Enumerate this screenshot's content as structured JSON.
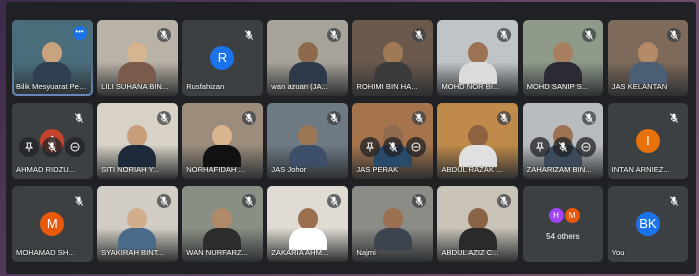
{
  "participants": [
    {
      "id": "p1",
      "name": "Bilik Mesyuarat Perdana",
      "type": "video",
      "bg": "#4a6d7c",
      "skin": "#c9a27e",
      "shirt": "#2f4050",
      "active": true,
      "options": "•••"
    },
    {
      "id": "p2",
      "name": "LILI SUHANA BIN...",
      "type": "video",
      "bg": "#b9b2a6",
      "skin": "#d6b48f",
      "shirt": "#7a5a4a"
    },
    {
      "id": "p3",
      "name": "Rusfahizan",
      "type": "avatar",
      "letter": "R",
      "avatar_color": "#1a73e8"
    },
    {
      "id": "p4",
      "name": "wan azuan (JA...",
      "type": "video",
      "bg": "#a8a39a",
      "skin": "#8e6a4c",
      "shirt": "#2e3a4a"
    },
    {
      "id": "p5",
      "name": "ROHIMI BIN HA...",
      "type": "video",
      "bg": "#6b5a4c",
      "skin": "#a07a58",
      "shirt": "#3b3b3b"
    },
    {
      "id": "p6",
      "name": "MOHD NOR BI...",
      "type": "video",
      "bg": "#bfc4c6",
      "skin": "#9b7354",
      "shirt": "#dcdcdc"
    },
    {
      "id": "p7",
      "name": "MOHD SANIP S...",
      "type": "video",
      "bg": "#8f9a8a",
      "skin": "#a87f5e",
      "shirt": "#2b2b33"
    },
    {
      "id": "p8",
      "name": "JAS KELANTAN",
      "type": "video",
      "bg": "#7d6a5a",
      "skin": "#b58a66",
      "shirt": "#4b5e73"
    },
    {
      "id": "p9",
      "name": "AHMAD RIDZU...",
      "type": "avatar",
      "letter": "A",
      "avatar_color": "#c5442f",
      "pinbar": true
    },
    {
      "id": "p10",
      "name": "SITI NORIAH Y...",
      "type": "video",
      "bg": "#d8d2c6",
      "skin": "#c79d7a",
      "shirt": "#1e2a3a"
    },
    {
      "id": "p11",
      "name": "NORHAFIDAH ...",
      "type": "video",
      "bg": "#9c8c7c",
      "skin": "#d9b48e",
      "shirt": "#111111"
    },
    {
      "id": "p12",
      "name": "JAS Johor",
      "type": "video",
      "bg": "#6e7a84",
      "skin": "#9d7656",
      "shirt": "#3c4e68"
    },
    {
      "id": "p13",
      "name": "JAS PERAK",
      "type": "video",
      "bg": "#a5744c",
      "skin": "#8f6a4c",
      "shirt": "#2a4a6a",
      "pinbar": true
    },
    {
      "id": "p14",
      "name": "ABDUL RAZAK ...",
      "type": "video",
      "bg": "#c08a4a",
      "skin": "#8c6242",
      "shirt": "#e0e0e0"
    },
    {
      "id": "p15",
      "name": "ZAHARIZAM BIN...",
      "type": "video",
      "bg": "#b9bcbe",
      "skin": "#9c7252",
      "shirt": "#3a4a5a",
      "pinbar": true
    },
    {
      "id": "p16",
      "name": "INTAN ARNIEZ...",
      "type": "avatar",
      "letter": "I",
      "avatar_color": "#e8710a"
    },
    {
      "id": "p17",
      "name": "MOHAMAD SH...",
      "type": "avatar",
      "letter": "M",
      "avatar_color": "#e8590c"
    },
    {
      "id": "p18",
      "name": "SYAKIRAH BINT...",
      "type": "video",
      "bg": "#d2cdc4",
      "skin": "#d1ad8b",
      "shirt": "#4a6a8a"
    },
    {
      "id": "p19",
      "name": "WAN NURFARZ...",
      "type": "video",
      "bg": "#8a8f84",
      "skin": "#b08a68",
      "shirt": "#2c2c2c"
    },
    {
      "id": "p20",
      "name": "ZAKARIA AHM...",
      "type": "video",
      "bg": "#e0dcd4",
      "skin": "#9a7050",
      "shirt": "#ffffff"
    },
    {
      "id": "p21",
      "name": "Najmi",
      "type": "video",
      "bg": "#8c8c86",
      "skin": "#9b7050",
      "shirt": "#3d4450"
    },
    {
      "id": "p22",
      "name": "ABDUL AZIZ C...",
      "type": "video",
      "bg": "#c9c3b8",
      "skin": "#8a6446",
      "shirt": "#2a2a2a"
    },
    {
      "id": "p23",
      "name": "",
      "type": "others",
      "count_label": "54 others",
      "mini": [
        {
          "letter": "H",
          "color": "#a142f4"
        },
        {
          "letter": "M",
          "color": "#e8590c"
        }
      ]
    },
    {
      "id": "p24",
      "name": "You",
      "type": "avatar",
      "letter": "BK",
      "avatar_color": "#1a73e8"
    }
  ]
}
